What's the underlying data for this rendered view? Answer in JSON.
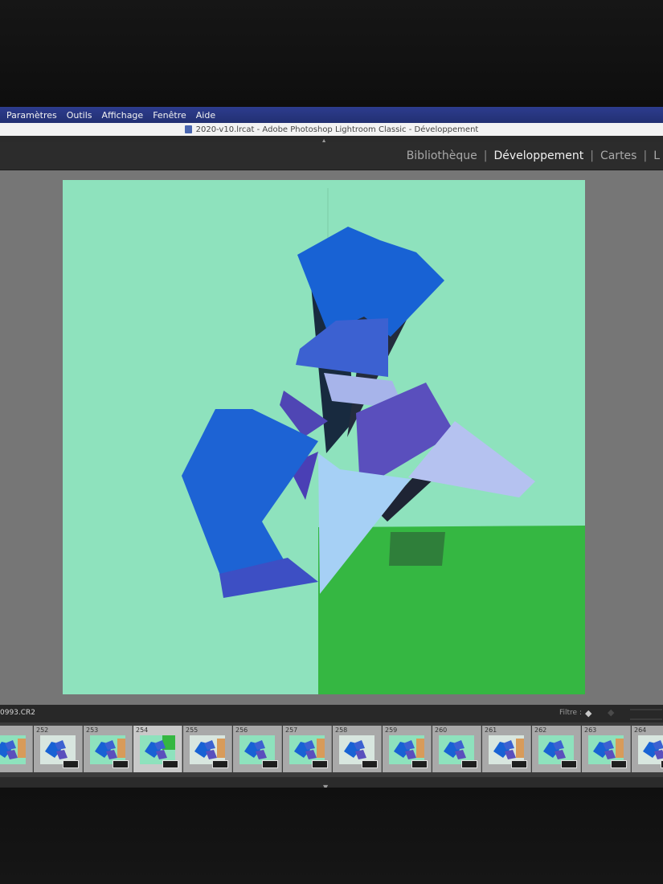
{
  "menu": [
    "Paramètres",
    "Outils",
    "Affichage",
    "Fenêtre",
    "Aide"
  ],
  "window_title": "2020-v10.lrcat - Adobe Photoshop Lightroom Classic - Développement",
  "modules": {
    "library": "Bibliothèque",
    "develop": "Développement",
    "map": "Cartes",
    "book": "L",
    "active": "Développement"
  },
  "filmstrip": {
    "filename": "0993.CR2",
    "filter_label": "Filtre :",
    "numbers": [
      "252",
      "253",
      "254",
      "255",
      "256",
      "257",
      "258",
      "259",
      "260",
      "261",
      "262",
      "263",
      "264"
    ],
    "selected_index": 2
  },
  "colors": {
    "menubar": "#253379",
    "background_mint": "#8ee2bd",
    "green_floor": "#35b742",
    "paper_blue": "#1862d4",
    "paper_purple": "#5a4fbd",
    "paper_light": "#b5c2f0"
  },
  "icons": {
    "collapse_top": "triangle-up-icon",
    "collapse_bottom": "triangle-down-icon",
    "filter": "diamond-icon"
  }
}
